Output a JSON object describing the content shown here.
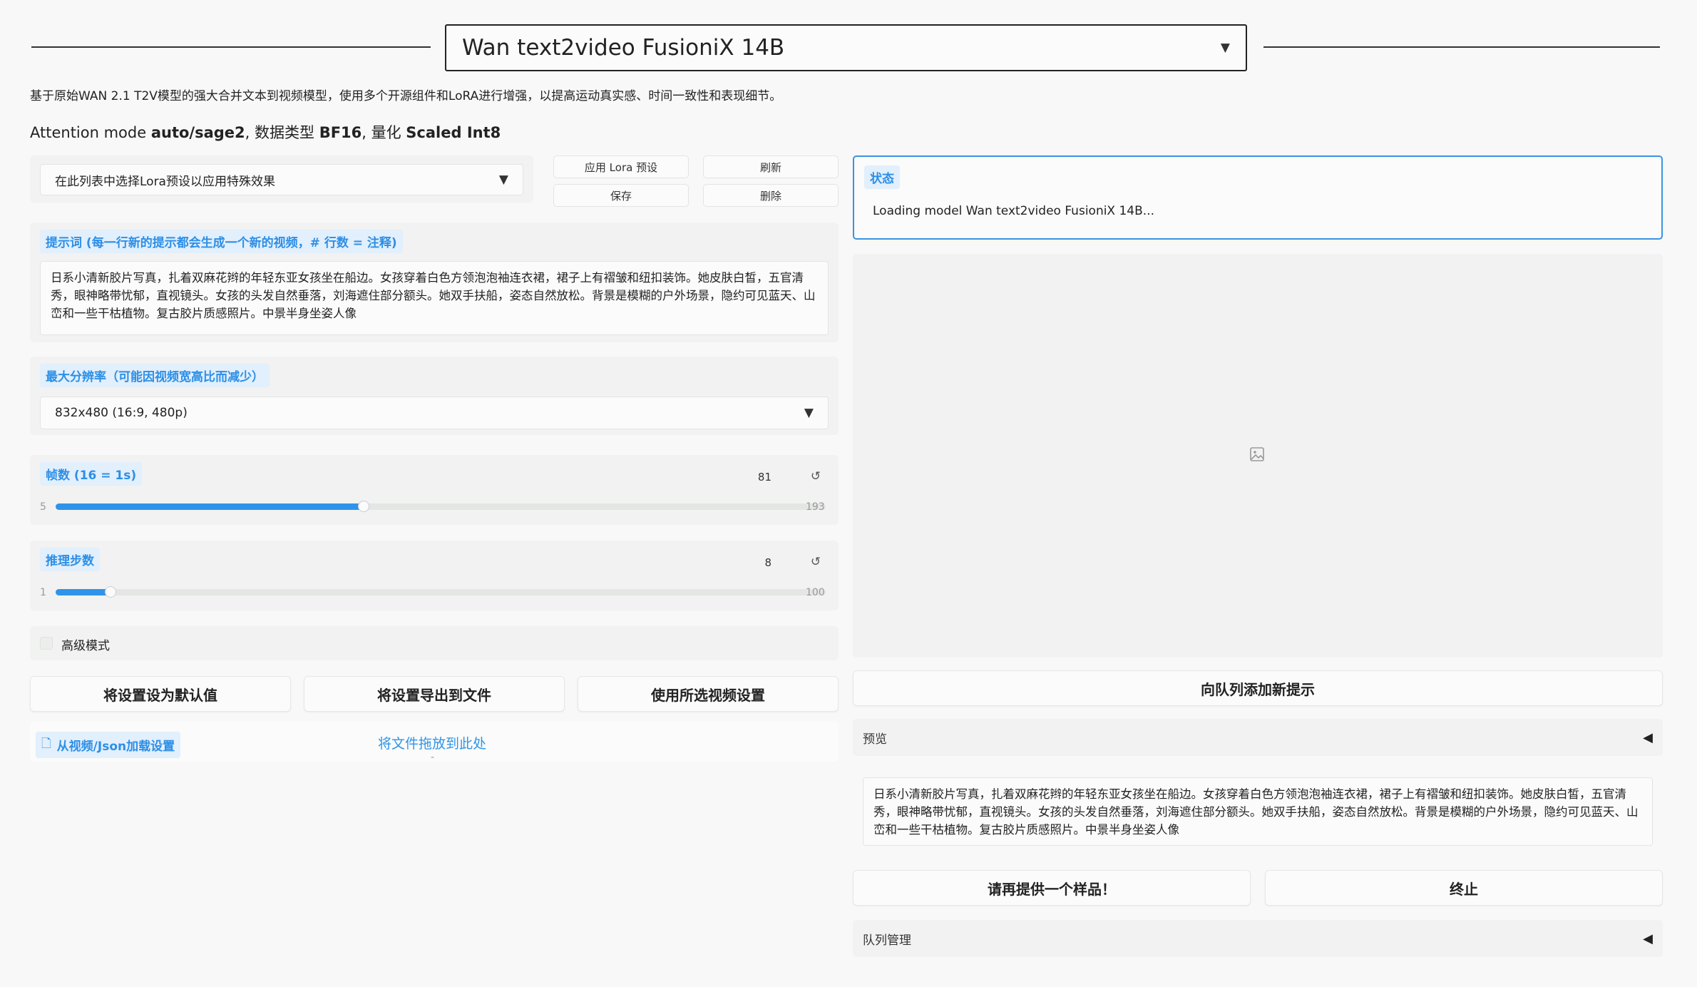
{
  "header": {
    "model_select_value": "Wan text2video FusioniX 14B",
    "description": "基于原始WAN 2.1 T2V模型的强大合并文本到视频模型，使用多个开源组件和LoRA进行增强，以提高运动真实感、时间一致性和表现细节。",
    "attention_prefix": "Attention mode ",
    "attention_mode": "auto/sage2",
    "datatype_prefix": ", 数据类型 ",
    "datatype": "BF16",
    "quant_prefix": ", 量化 ",
    "quant": "Scaled Int8"
  },
  "lora": {
    "select_placeholder": "在此列表中选择Lora预设以应用特殊效果",
    "apply_label": "应用 Lora 预设",
    "refresh_label": "刷新",
    "save_label": "保存",
    "delete_label": "删除"
  },
  "prompt": {
    "label": "提示词 (每一行新的提示都会生成一个新的视频，# 行数 = 注释)",
    "text": "日系小清新胶片写真，扎着双麻花辫的年轻东亚女孩坐在船边。女孩穿着白色方领泡泡袖连衣裙，裙子上有褶皱和纽扣装饰。她皮肤白皙，五官清秀，眼神略带忧郁，直视镜头。女孩的头发自然垂落，刘海遮住部分额头。她双手扶船，姿态自然放松。背景是模糊的户外场景，隐约可见蓝天、山峦和一些干枯植物。复古胶片质感照片。中景半身坐姿人像"
  },
  "resolution": {
    "label": "最大分辨率（可能因视频宽高比而减少）",
    "value": "832x480 (16:9, 480p)"
  },
  "frames": {
    "label": "帧数 (16 = 1s)",
    "value": "81",
    "min": "5",
    "max": "193",
    "fraction": 0.4
  },
  "steps": {
    "label": "推理步数",
    "value": "8",
    "min": "1",
    "max": "100",
    "fraction": 0.071
  },
  "advanced": {
    "label": "高级模式",
    "checked": false
  },
  "buttons": {
    "set_default": "将设置设为默认值",
    "export": "将设置导出到文件",
    "use_video_settings": "使用所选视频设置"
  },
  "load_settings": {
    "label": "从视频/Json加载设置",
    "drop_text": "将文件拖放到此处",
    "separator": "-"
  },
  "status": {
    "label": "状态",
    "text": "Loading model Wan text2video FusioniX 14B..."
  },
  "right": {
    "add_prompt_button": "向队列添加新提示",
    "preview_label": "预览",
    "prompt_copy": "日系小清新胶片写真，扎着双麻花辫的年轻东亚女孩坐在船边。女孩穿着白色方领泡泡袖连衣裙，裙子上有褶皱和纽扣装饰。她皮肤白皙，五官清秀，眼神略带忧郁，直视镜头。女孩的头发自然垂落，刘海遮住部分额头。她双手扶船，姿态自然放松。背景是模糊的户外场景，隐约可见蓝天、山峦和一些干枯植物。复古胶片质感照片。中景半身坐姿人像",
    "another_sample_button": "请再提供一个样品！",
    "abort_button": "终止",
    "queue_label": "队列管理"
  },
  "colors": {
    "accent": "#2f94e9",
    "chip_bg": "#e2effc",
    "status_border": "#3b93e3"
  },
  "icons": {
    "dropdown": "triangle-down",
    "reset": "reset",
    "image_placeholder": "image",
    "collapse": "triangle-left",
    "file": "file"
  }
}
